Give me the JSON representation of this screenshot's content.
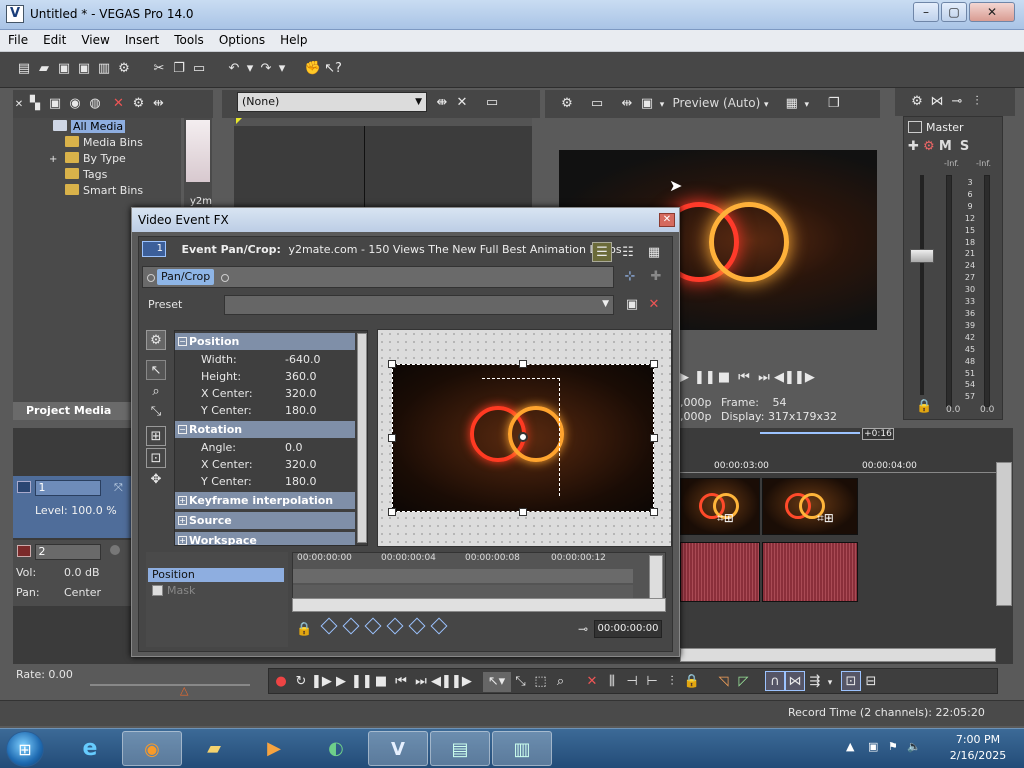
{
  "window": {
    "title": "Untitled * - VEGAS Pro 14.0"
  },
  "menu": [
    "File",
    "Edit",
    "View",
    "Insert",
    "Tools",
    "Options",
    "Help"
  ],
  "explorer": {
    "items": [
      "All Media",
      "Media Bins",
      "By Type",
      "Tags",
      "Smart Bins"
    ],
    "thumb_label": "y2m",
    "tab": "Project Media"
  },
  "trimmer": {
    "dropdown": "(None)"
  },
  "preview": {
    "mode": "Preview (Auto)",
    "project_suffix": ",000p",
    "frame_label": "Frame:",
    "frame": "54",
    "preview_suffix": ",000p",
    "display_label": "Display:",
    "display": "317x179x32"
  },
  "mixer": {
    "label": "Master",
    "m": "M",
    "s": "S",
    "inf_left": "-Inf.",
    "inf_right": "-Inf.",
    "scale": [
      "3",
      "6",
      "9",
      "12",
      "15",
      "18",
      "21",
      "24",
      "27",
      "30",
      "33",
      "36",
      "39",
      "42",
      "45",
      "48",
      "51",
      "54",
      "57"
    ],
    "bottom_left": "0.0",
    "bottom_right": "0.0"
  },
  "timeline": {
    "marker": "+0:16",
    "ruler": [
      "00:00:03:00",
      "00:00:04:00"
    ],
    "track1": {
      "num": "1",
      "level": "Level: 100.0 %"
    },
    "track2": {
      "num": "2",
      "vol_label": "Vol:",
      "vol": "0.0 dB",
      "pan_label": "Pan:",
      "pan": "Center"
    },
    "rate": "Rate: 0.00"
  },
  "status": {
    "record": "Record Time (2 channels): 22:05:20"
  },
  "dialog": {
    "title": "Video Event FX",
    "event_label": "Event Pan/Crop:",
    "event_name": "y2mate.com - 150 Views The New Full Best Animation Logos",
    "chain_item": "Pan/Crop",
    "preset_label": "Preset",
    "sections": {
      "position": "Position",
      "rotation": "Rotation",
      "keyframe": "Keyframe interpolation",
      "source": "Source",
      "workspace": "Workspace"
    },
    "position_rows": [
      {
        "k": "Width:",
        "v": "-640.0"
      },
      {
        "k": "Height:",
        "v": "360.0"
      },
      {
        "k": "X Center:",
        "v": "320.0"
      },
      {
        "k": "Y Center:",
        "v": "180.0"
      }
    ],
    "rotation_rows": [
      {
        "k": "Angle:",
        "v": "0.0"
      },
      {
        "k": "X Center:",
        "v": "320.0"
      },
      {
        "k": "Y Center:",
        "v": "180.0"
      }
    ],
    "kf_tracks": [
      "Position",
      "Mask"
    ],
    "kf_ruler": [
      "00:00:00:00",
      "00:00:00:04",
      "00:00:00:08",
      "00:00:00:12"
    ],
    "kf_time": "00:00:00:00"
  },
  "taskbar": {
    "time": "7:00 PM",
    "date": "2/16/2025"
  },
  "colors": {
    "accent": "#9cc3ff",
    "panel": "#464646",
    "selection": "#8eaee0"
  }
}
